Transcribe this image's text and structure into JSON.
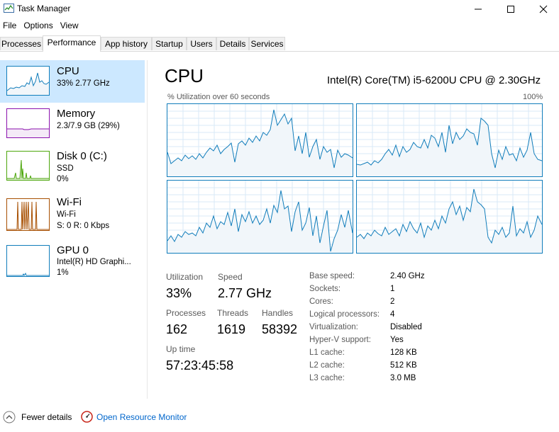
{
  "window": {
    "title": "Task Manager",
    "minimize": "—",
    "maximize": "☐",
    "close": "✕"
  },
  "menu": [
    "File",
    "Options",
    "View"
  ],
  "tabs": [
    "Processes",
    "Performance",
    "App history",
    "Startup",
    "Users",
    "Details",
    "Services"
  ],
  "active_tab": "Performance",
  "sidebar": {
    "items": [
      {
        "name": "CPU",
        "line1": "33%  2.77 GHz",
        "line2": "",
        "color": "#117dbb"
      },
      {
        "name": "Memory",
        "line1": "2.3/7.9 GB (29%)",
        "line2": "",
        "color": "#8b12ae"
      },
      {
        "name": "Disk 0 (C:)",
        "line1": "SSD",
        "line2": "0%",
        "color": "#4da60c"
      },
      {
        "name": "Wi-Fi",
        "line1": "Wi-Fi",
        "line2": "S: 0  R: 0 Kbps",
        "color": "#a74f01"
      },
      {
        "name": "GPU 0",
        "line1": "Intel(R) HD Graphi...",
        "line2": "1%",
        "color": "#117dbb"
      }
    ]
  },
  "main": {
    "title": "CPU",
    "model": "Intel(R) Core(TM) i5-6200U CPU @ 2.30GHz",
    "util_label": "% Utilization over 60 seconds",
    "max_label": "100%",
    "stats": {
      "utilization_label": "Utilization",
      "utilization": "33%",
      "speed_label": "Speed",
      "speed": "2.77 GHz",
      "processes_label": "Processes",
      "processes": "162",
      "threads_label": "Threads",
      "threads": "1619",
      "handles_label": "Handles",
      "handles": "58392",
      "uptime_label": "Up time",
      "uptime": "57:23:45:58"
    },
    "details": [
      {
        "label": "Base speed:",
        "value": "2.40 GHz"
      },
      {
        "label": "Sockets:",
        "value": "1"
      },
      {
        "label": "Cores:",
        "value": "2"
      },
      {
        "label": "Logical processors:",
        "value": "4"
      },
      {
        "label": "Virtualization:",
        "value": "Disabled"
      },
      {
        "label": "Hyper-V support:",
        "value": "Yes"
      },
      {
        "label": "L1 cache:",
        "value": "128 KB"
      },
      {
        "label": "L2 cache:",
        "value": "512 KB"
      },
      {
        "label": "L3 cache:",
        "value": "3.0 MB"
      }
    ]
  },
  "footer": {
    "fewer_details": "Fewer details",
    "resource_monitor": "Open Resource Monitor"
  },
  "colors": {
    "cpu": "#117dbb",
    "cpu_fill": "#f1f6fa",
    "selected": "#cce8ff"
  }
}
